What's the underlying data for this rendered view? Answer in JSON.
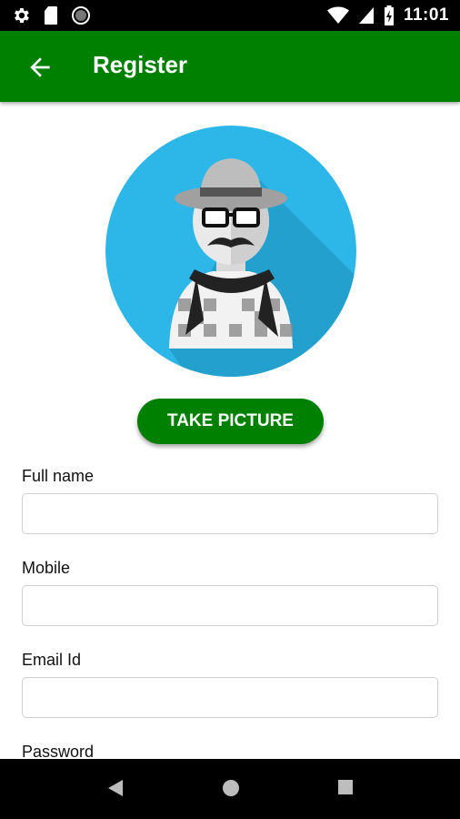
{
  "status_bar": {
    "time": "11:01",
    "left_icons": [
      "gear-icon",
      "sd-card-icon",
      "record-icon"
    ],
    "right_icons": [
      "wifi-icon",
      "signal-icon",
      "battery-icon"
    ]
  },
  "app_bar": {
    "title": "Register",
    "back_icon": "arrow-left-icon",
    "color": "#008000"
  },
  "avatar": {
    "icon": "hipster-avatar-icon",
    "background": "#2DB6E8"
  },
  "take_picture_button": {
    "label": "TAKE PICTURE"
  },
  "form": {
    "fields": [
      {
        "label": "Full name",
        "value": "",
        "placeholder": ""
      },
      {
        "label": "Mobile",
        "value": "",
        "placeholder": ""
      },
      {
        "label": "Email Id",
        "value": "",
        "placeholder": ""
      },
      {
        "label": "Password"
      }
    ]
  },
  "nav_bar": {
    "icons": [
      "back-triangle-icon",
      "home-circle-icon",
      "recents-square-icon"
    ]
  }
}
